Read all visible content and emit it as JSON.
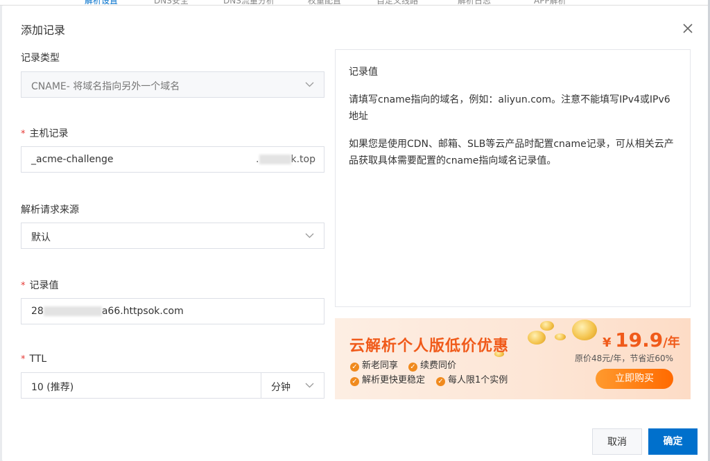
{
  "bg_tabs": [
    "解析设置",
    "DNS安全",
    "DNS流量分析",
    "权重配置",
    "自定义线路",
    "解析日志",
    "APP解析"
  ],
  "dialog": {
    "title": "添加记录",
    "close_icon": "close-icon"
  },
  "form": {
    "record_type": {
      "label": "记录类型",
      "value": "CNAME- 将域名指向另外一个域名"
    },
    "host": {
      "label": "主机记录",
      "required_mark": "*",
      "value": "_acme-challenge",
      "suffix": "k.top"
    },
    "source": {
      "label": "解析请求来源",
      "value": "默认"
    },
    "record_value": {
      "label": "记录值",
      "required_mark": "*",
      "value_prefix": "28",
      "value_suffix": "a66.httpsok.com"
    },
    "ttl": {
      "label": "TTL",
      "required_mark": "*",
      "value": "10 (推荐)",
      "unit": "分钟"
    }
  },
  "help": {
    "heading": "记录值",
    "p1": "请填写cname指向的域名，例如：aliyun.com。注意不能填写IPv4或IPv6地址",
    "p2": "如果您是使用CDN、邮箱、SLB等云产品时配置cname记录，可从相关云产品获取具体需要配置的cname指向域名记录值。"
  },
  "promo": {
    "title": "云解析个人版低价优惠",
    "features": [
      "新老同享",
      "续费同价",
      "解析更快更稳定",
      "每人限1个实例"
    ],
    "currency": "¥",
    "price": "19.9",
    "per": "/年",
    "original": "原价48元/年，节省近60%",
    "buy_label": "立即购买",
    "accent": "#f05a1a"
  },
  "footer": {
    "cancel_label": "取消",
    "ok_label": "确定",
    "primary_color": "#0070cc"
  }
}
